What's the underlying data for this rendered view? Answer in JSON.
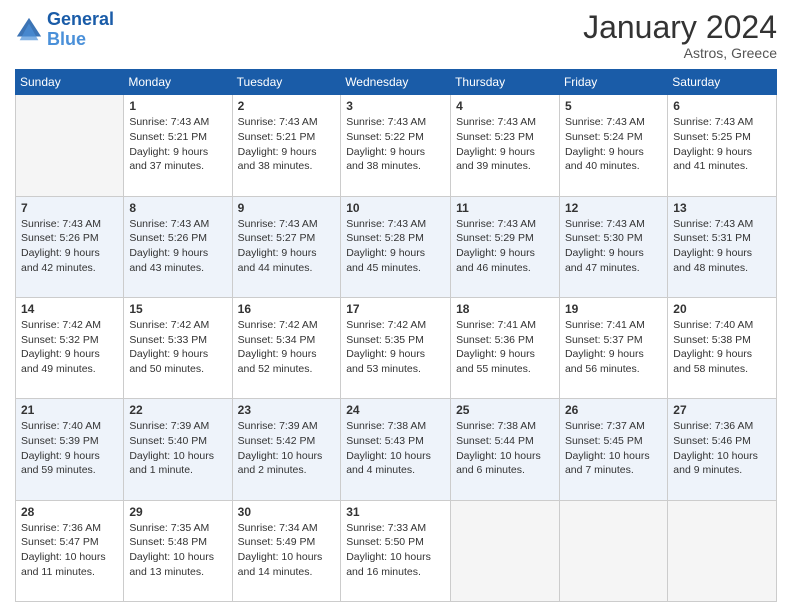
{
  "header": {
    "logo_line1": "General",
    "logo_line2": "Blue",
    "month_year": "January 2024",
    "location": "Astros, Greece"
  },
  "weekdays": [
    "Sunday",
    "Monday",
    "Tuesday",
    "Wednesday",
    "Thursday",
    "Friday",
    "Saturday"
  ],
  "weeks": [
    [
      {
        "day": "",
        "empty": true
      },
      {
        "day": "1",
        "sunrise": "Sunrise: 7:43 AM",
        "sunset": "Sunset: 5:21 PM",
        "daylight": "Daylight: 9 hours and 37 minutes."
      },
      {
        "day": "2",
        "sunrise": "Sunrise: 7:43 AM",
        "sunset": "Sunset: 5:21 PM",
        "daylight": "Daylight: 9 hours and 38 minutes."
      },
      {
        "day": "3",
        "sunrise": "Sunrise: 7:43 AM",
        "sunset": "Sunset: 5:22 PM",
        "daylight": "Daylight: 9 hours and 38 minutes."
      },
      {
        "day": "4",
        "sunrise": "Sunrise: 7:43 AM",
        "sunset": "Sunset: 5:23 PM",
        "daylight": "Daylight: 9 hours and 39 minutes."
      },
      {
        "day": "5",
        "sunrise": "Sunrise: 7:43 AM",
        "sunset": "Sunset: 5:24 PM",
        "daylight": "Daylight: 9 hours and 40 minutes."
      },
      {
        "day": "6",
        "sunrise": "Sunrise: 7:43 AM",
        "sunset": "Sunset: 5:25 PM",
        "daylight": "Daylight: 9 hours and 41 minutes."
      }
    ],
    [
      {
        "day": "7",
        "sunrise": "Sunrise: 7:43 AM",
        "sunset": "Sunset: 5:26 PM",
        "daylight": "Daylight: 9 hours and 42 minutes."
      },
      {
        "day": "8",
        "sunrise": "Sunrise: 7:43 AM",
        "sunset": "Sunset: 5:26 PM",
        "daylight": "Daylight: 9 hours and 43 minutes."
      },
      {
        "day": "9",
        "sunrise": "Sunrise: 7:43 AM",
        "sunset": "Sunset: 5:27 PM",
        "daylight": "Daylight: 9 hours and 44 minutes."
      },
      {
        "day": "10",
        "sunrise": "Sunrise: 7:43 AM",
        "sunset": "Sunset: 5:28 PM",
        "daylight": "Daylight: 9 hours and 45 minutes."
      },
      {
        "day": "11",
        "sunrise": "Sunrise: 7:43 AM",
        "sunset": "Sunset: 5:29 PM",
        "daylight": "Daylight: 9 hours and 46 minutes."
      },
      {
        "day": "12",
        "sunrise": "Sunrise: 7:43 AM",
        "sunset": "Sunset: 5:30 PM",
        "daylight": "Daylight: 9 hours and 47 minutes."
      },
      {
        "day": "13",
        "sunrise": "Sunrise: 7:43 AM",
        "sunset": "Sunset: 5:31 PM",
        "daylight": "Daylight: 9 hours and 48 minutes."
      }
    ],
    [
      {
        "day": "14",
        "sunrise": "Sunrise: 7:42 AM",
        "sunset": "Sunset: 5:32 PM",
        "daylight": "Daylight: 9 hours and 49 minutes."
      },
      {
        "day": "15",
        "sunrise": "Sunrise: 7:42 AM",
        "sunset": "Sunset: 5:33 PM",
        "daylight": "Daylight: 9 hours and 50 minutes."
      },
      {
        "day": "16",
        "sunrise": "Sunrise: 7:42 AM",
        "sunset": "Sunset: 5:34 PM",
        "daylight": "Daylight: 9 hours and 52 minutes."
      },
      {
        "day": "17",
        "sunrise": "Sunrise: 7:42 AM",
        "sunset": "Sunset: 5:35 PM",
        "daylight": "Daylight: 9 hours and 53 minutes."
      },
      {
        "day": "18",
        "sunrise": "Sunrise: 7:41 AM",
        "sunset": "Sunset: 5:36 PM",
        "daylight": "Daylight: 9 hours and 55 minutes."
      },
      {
        "day": "19",
        "sunrise": "Sunrise: 7:41 AM",
        "sunset": "Sunset: 5:37 PM",
        "daylight": "Daylight: 9 hours and 56 minutes."
      },
      {
        "day": "20",
        "sunrise": "Sunrise: 7:40 AM",
        "sunset": "Sunset: 5:38 PM",
        "daylight": "Daylight: 9 hours and 58 minutes."
      }
    ],
    [
      {
        "day": "21",
        "sunrise": "Sunrise: 7:40 AM",
        "sunset": "Sunset: 5:39 PM",
        "daylight": "Daylight: 9 hours and 59 minutes."
      },
      {
        "day": "22",
        "sunrise": "Sunrise: 7:39 AM",
        "sunset": "Sunset: 5:40 PM",
        "daylight": "Daylight: 10 hours and 1 minute."
      },
      {
        "day": "23",
        "sunrise": "Sunrise: 7:39 AM",
        "sunset": "Sunset: 5:42 PM",
        "daylight": "Daylight: 10 hours and 2 minutes."
      },
      {
        "day": "24",
        "sunrise": "Sunrise: 7:38 AM",
        "sunset": "Sunset: 5:43 PM",
        "daylight": "Daylight: 10 hours and 4 minutes."
      },
      {
        "day": "25",
        "sunrise": "Sunrise: 7:38 AM",
        "sunset": "Sunset: 5:44 PM",
        "daylight": "Daylight: 10 hours and 6 minutes."
      },
      {
        "day": "26",
        "sunrise": "Sunrise: 7:37 AM",
        "sunset": "Sunset: 5:45 PM",
        "daylight": "Daylight: 10 hours and 7 minutes."
      },
      {
        "day": "27",
        "sunrise": "Sunrise: 7:36 AM",
        "sunset": "Sunset: 5:46 PM",
        "daylight": "Daylight: 10 hours and 9 minutes."
      }
    ],
    [
      {
        "day": "28",
        "sunrise": "Sunrise: 7:36 AM",
        "sunset": "Sunset: 5:47 PM",
        "daylight": "Daylight: 10 hours and 11 minutes."
      },
      {
        "day": "29",
        "sunrise": "Sunrise: 7:35 AM",
        "sunset": "Sunset: 5:48 PM",
        "daylight": "Daylight: 10 hours and 13 minutes."
      },
      {
        "day": "30",
        "sunrise": "Sunrise: 7:34 AM",
        "sunset": "Sunset: 5:49 PM",
        "daylight": "Daylight: 10 hours and 14 minutes."
      },
      {
        "day": "31",
        "sunrise": "Sunrise: 7:33 AM",
        "sunset": "Sunset: 5:50 PM",
        "daylight": "Daylight: 10 hours and 16 minutes."
      },
      {
        "day": "",
        "empty": true
      },
      {
        "day": "",
        "empty": true
      },
      {
        "day": "",
        "empty": true
      }
    ]
  ]
}
